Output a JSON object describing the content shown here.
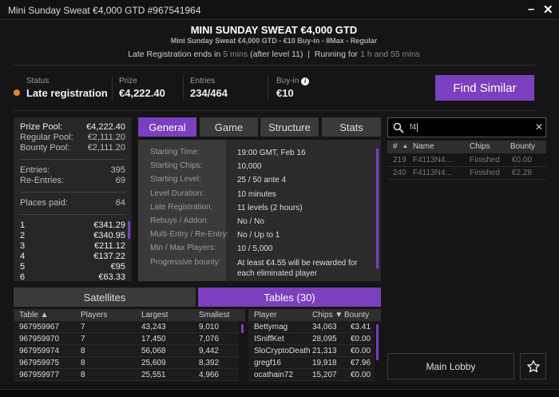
{
  "window": {
    "title": "Mini Sunday Sweat €4,000 GTD #967541964",
    "minimize": "–",
    "close": "✕"
  },
  "header": {
    "title": "MINI SUNDAY SWEAT €4,000 GTD",
    "subtitle": "Mini Sunday Sweat €4,000 GTD - €10 Buy-in - 8Max - Regular",
    "late_prefix": "Late Registration ends in ",
    "late_time": "5 mins",
    "late_suffix": " (after level 11)  |  Running for ",
    "running": "1 h and 55 mins"
  },
  "stats": {
    "status_label": "Status",
    "status": "Late registration",
    "status_color": "#e8832a",
    "prize_label": "Prize",
    "prize": "€4,222.40",
    "entries_label": "Entries",
    "entries": "234/464",
    "buyin_label": "Buy-in",
    "buyin": "€10",
    "find_similar": "Find Similar"
  },
  "prize_panel": {
    "pools": [
      [
        "Prize Pool:",
        "€4,222.40"
      ],
      [
        "Regular Pool:",
        "€2,111.20"
      ],
      [
        "Bounty Pool:",
        "€2,111.20"
      ]
    ],
    "entries": [
      [
        "Entries:",
        "395"
      ],
      [
        "Re-Entries:",
        "69"
      ]
    ],
    "places": [
      "Places paid:",
      "64"
    ],
    "payouts": [
      [
        "1",
        "€341.29"
      ],
      [
        "2",
        "€340.95"
      ],
      [
        "3",
        "€211.12"
      ],
      [
        "4",
        "€137.22"
      ],
      [
        "5",
        "€95"
      ],
      [
        "6",
        "€63.33"
      ]
    ]
  },
  "tabs": [
    "General",
    "Game",
    "Structure",
    "Stats"
  ],
  "general": [
    [
      "Starting Time:",
      "19:00 GMT, Feb 16"
    ],
    [
      "Starting Chips:",
      "10,000"
    ],
    [
      "Starting Level:",
      "25 / 50 ante 4"
    ],
    [
      "Level Duration:",
      "10 minutes"
    ],
    [
      "Late Registration:",
      "11 levels (2 hours)"
    ],
    [
      "Rebuys / Addon:",
      "No / No"
    ],
    [
      "Multi-Entry / Re-Entry:",
      "No / Up to 1"
    ],
    [
      "Min / Max Players:",
      "10 / 5,000"
    ],
    [
      "Progressive bounty:",
      "At least €4.55 will be rewarded for each eliminated player"
    ]
  ],
  "bottom_tabs": {
    "satellites": "Satellites",
    "tables": "Tables (30)"
  },
  "tables": {
    "headers": [
      "Table ▲",
      "Players",
      "Largest",
      "Smallest"
    ],
    "rows": [
      [
        "967959967",
        "7",
        "43,243",
        "9,010"
      ],
      [
        "967959970",
        "7",
        "17,450",
        "7,076"
      ],
      [
        "967959974",
        "8",
        "56,068",
        "9,442"
      ],
      [
        "967959975",
        "8",
        "25,609",
        "8,392"
      ],
      [
        "967959977",
        "8",
        "25,551",
        "4,966"
      ]
    ]
  },
  "players": {
    "headers": [
      "Player",
      "Chips ▼",
      "Bounty"
    ],
    "rows": [
      [
        "Bettymag",
        "34,063",
        "€3.41"
      ],
      [
        "ISniffKet",
        "28,095",
        "€0.00"
      ],
      [
        "SloCryptoDeath",
        "21,313",
        "€0.00"
      ],
      [
        "gregf16",
        "19,918",
        "€7.96"
      ],
      [
        "ocathain72",
        "15,207",
        "€0.00"
      ]
    ]
  },
  "search": {
    "value": "f4",
    "headers": [
      "#",
      "▲",
      "Name",
      "Chips",
      "Bounty"
    ],
    "rows": [
      [
        "219",
        "F4113N4...",
        "Finished",
        "€0.00"
      ],
      [
        "240",
        "F4113N4...",
        "Finished",
        "€2.28"
      ]
    ]
  },
  "main_lobby": "Main Lobby",
  "accent": "#7b3fbf"
}
